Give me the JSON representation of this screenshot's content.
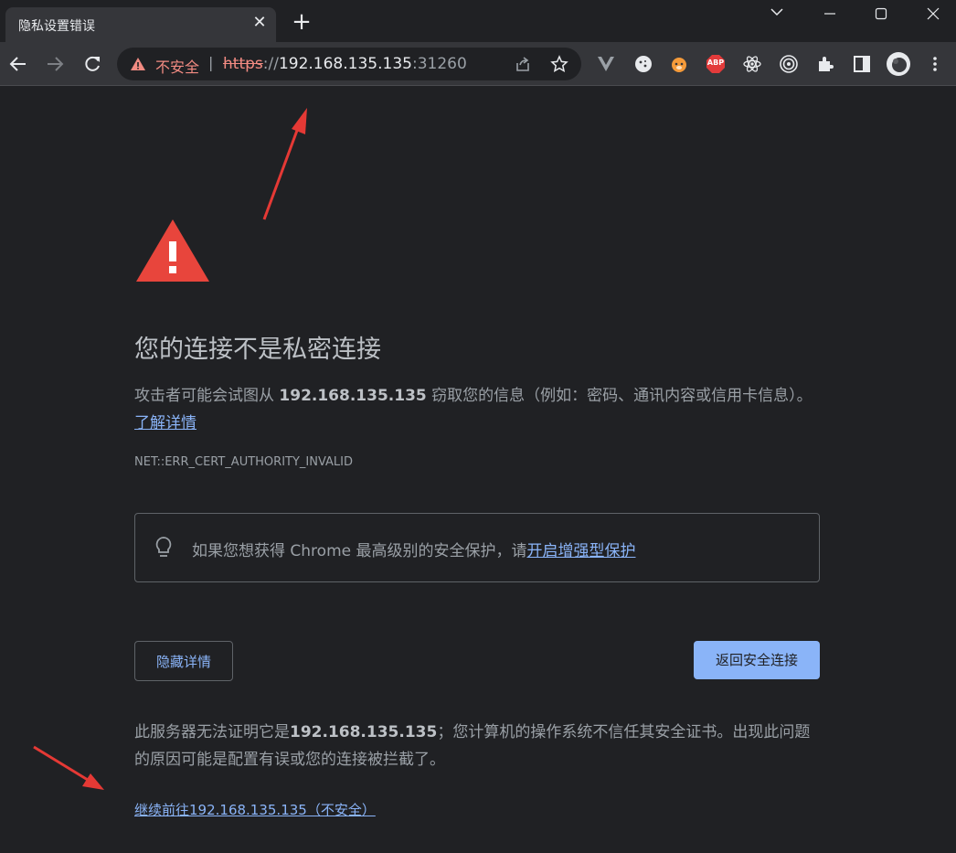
{
  "browser": {
    "tab_title": "隐私设置错误",
    "tab_close": "✕",
    "new_tab": "+",
    "omnibox": {
      "security_label": "不安全",
      "separator": "|",
      "url_scheme": "https",
      "url_sep": "://",
      "url_host": "192.168.135.135",
      "url_port": ":31260"
    },
    "extensions": [
      "vue-devtools-icon",
      "cookie-icon",
      "brave-lion-icon",
      "adblock-plus-icon",
      "react-devtools-icon",
      "target-icon",
      "puzzle-extensions-icon",
      "sidepanel-icon",
      "avatar",
      "kebab-menu-icon"
    ],
    "adblock_label": "ABP"
  },
  "page": {
    "heading": "您的连接不是私密连接",
    "para_pre": "攻击者可能会试图从 ",
    "para_host": "192.168.135.135",
    "para_post": " 窃取您的信息（例如：密码、通讯内容或信用卡信息）。",
    "learn_more": "了解详情",
    "error_code": "NET::ERR_CERT_AUTHORITY_INVALID",
    "info_text": "如果您想获得 Chrome 最高级别的安全保护，请",
    "info_link": "开启增强型保护",
    "hide_details": "隐藏详情",
    "back_to_safety": "返回安全连接",
    "detail_pre": "此服务器无法证明它是",
    "detail_host": "192.168.135.135",
    "detail_post": "；您计算机的操作系统不信任其安全证书。出现此问题的原因可能是配置有误或您的连接被拦截了。",
    "proceed_link": "继续前往192.168.135.135（不安全）"
  },
  "colors": {
    "background": "#202124",
    "accent": "#8ab4f8",
    "warning": "#e8453c",
    "insecure": "#f28b82",
    "annotation_arrow": "#e53935"
  }
}
